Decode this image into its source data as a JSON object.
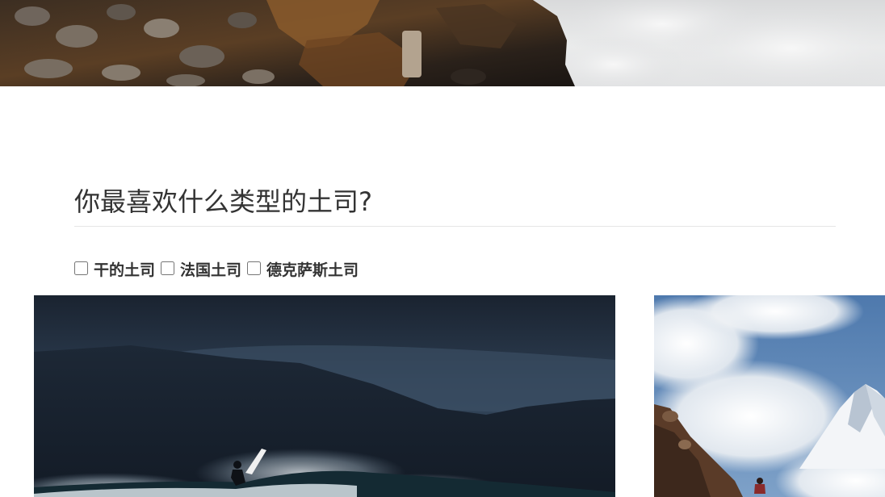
{
  "question": {
    "heading": "你最喜欢什么类型的土司?"
  },
  "options": [
    {
      "label": "干的土司",
      "checked": false
    },
    {
      "label": "法国土司",
      "checked": false
    },
    {
      "label": "德克萨斯土司",
      "checked": false
    }
  ],
  "images": {
    "hero_top": "rocky-cliff-with-clouds-photo",
    "surfer": "surfer-on-dark-wave-photo",
    "mountain": "snowy-mountain-hiker-photo"
  }
}
